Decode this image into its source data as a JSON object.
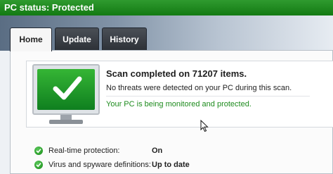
{
  "status": {
    "text": "PC status: Protected",
    "color": "#1a851a"
  },
  "tabs": [
    {
      "label": "Home",
      "active": true
    },
    {
      "label": "Update",
      "active": false
    },
    {
      "label": "History",
      "active": false
    }
  ],
  "scan": {
    "title": "Scan completed on 71207 items.",
    "detail": "No threats were detected on your PC during this scan.",
    "protected_message": "Your PC is being monitored and protected."
  },
  "status_items": [
    {
      "label": "Real-time protection:",
      "value": "On"
    },
    {
      "label": "Virus and spyware definitions:",
      "value": "Up to date"
    }
  ],
  "icons": {
    "monitor": "monitor-check-icon",
    "status_check": "green-check-circle-icon",
    "cursor": "mouse-pointer-icon"
  }
}
